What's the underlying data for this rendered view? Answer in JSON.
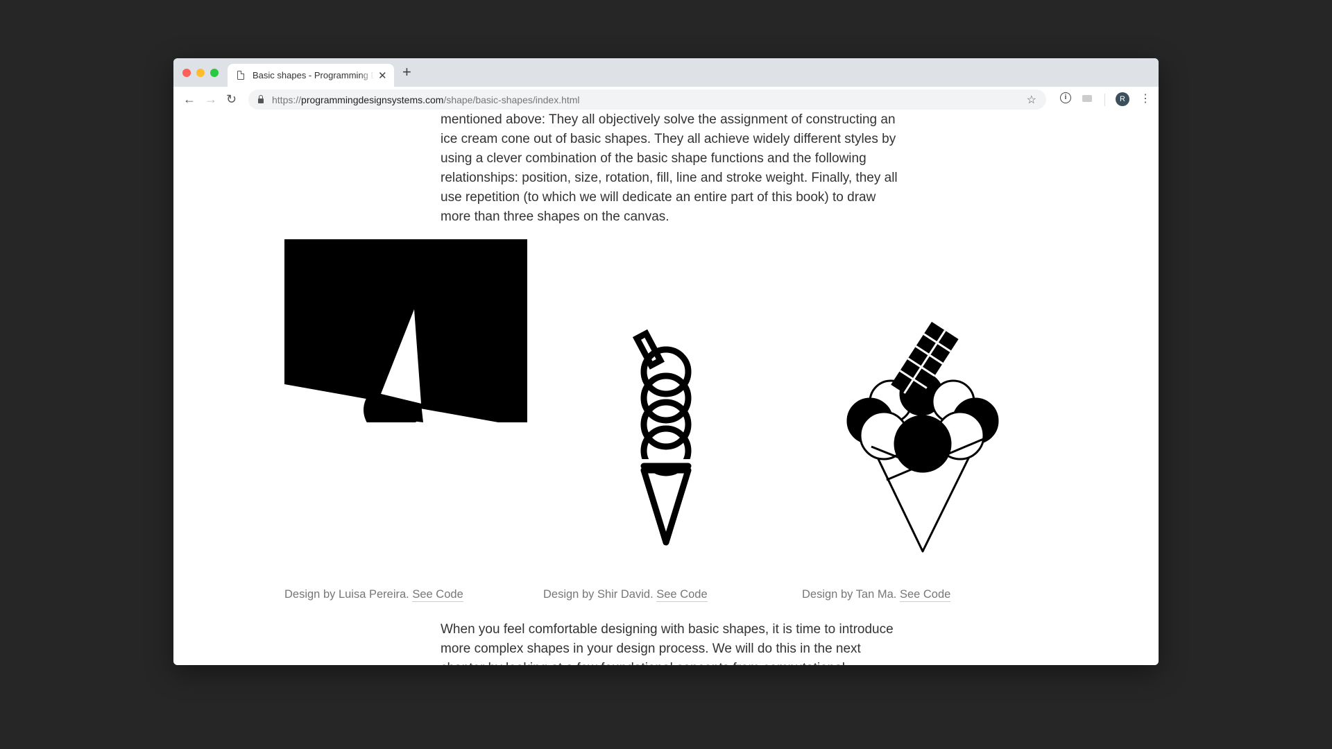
{
  "browser": {
    "tab_title": "Basic shapes - Programming Design Systems",
    "new_tab_label": "+",
    "url_scheme": "https://",
    "url_host": "programmingdesignsystems.com",
    "url_path": "/shape/basic-shapes/index.html",
    "avatar_initial": "R",
    "icons": {
      "back": "←",
      "forward": "→",
      "reload": "↻",
      "star": "☆",
      "close": "✕",
      "menu": "⋮",
      "extension1": "i"
    }
  },
  "article": {
    "paragraph_intro": "mentioned above: They all objectively solve the assignment of constructing an ice cream cone out of basic shapes. They all achieve widely different styles by using a clever combination of the basic shape functions and the following relationships: position, size, rotation, fill, line and stroke weight. Finally, they all use repetition (to which we will dedicate an entire part of this book) to draw more than three shapes on the canvas.",
    "figures": [
      {
        "caption": "Design by Luisa Pereira.",
        "link": "See Code"
      },
      {
        "caption": "Design by Shir David.",
        "link": "See Code"
      },
      {
        "caption": "Design by Tan Ma.",
        "link": "See Code"
      }
    ],
    "paragraph_outro": "When you feel comfortable designing with basic shapes, it is time to introduce more complex shapes in your design process. We will do this in the next chapter by looking at a few foundational concepts from computational geometry before venturing into procedural shape generation."
  },
  "colors": {
    "desktop": "#262626",
    "tabbar": "#dee1e6",
    "text": "#333333",
    "caption": "#777777"
  }
}
